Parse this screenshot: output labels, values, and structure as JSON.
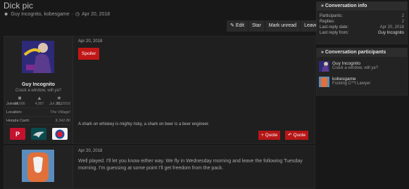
{
  "thread": {
    "title": "Dick pic",
    "participants_line": "Guy Incognito, kobesgame",
    "sep": "·",
    "date": "Apr 20, 2018"
  },
  "actions": {
    "edit": "Edit",
    "star": "Star",
    "mark_unread": "Mark unread",
    "leave": "Leave"
  },
  "post1": {
    "date": "Apr 20, 2018",
    "user": {
      "name": "Guy Incognito",
      "title": "Crack a window, will ya?"
    },
    "stats": [
      {
        "icon": "messages-icon",
        "value": "24,006"
      },
      {
        "icon": "thumbs-up-icon",
        "value": "4,997"
      },
      {
        "icon": "trophy-icon",
        "value": "293"
      }
    ],
    "fields": [
      {
        "label": "Joined:",
        "value": "Jul 26, 2016"
      },
      {
        "label": "Location:",
        "value": "The Village!"
      },
      {
        "label": "Hoopla Cash:",
        "value": "$ 342.86"
      }
    ],
    "spoiler": "Spoiler",
    "signature": "A shark on whiskey is mighty risky, a shark on beer is a beer engineer.",
    "quote_plus": "+ Quote",
    "quote": "Quote"
  },
  "post2": {
    "date": "Apr 20, 2018",
    "body": "Well played. I'll let you know either way. We fly in Wednesday morning and leave the following Tuesday morning. I'm guessing at some point I'll get freedom from the pack."
  },
  "conv_info": {
    "heading": "Conversation info",
    "rows": [
      {
        "label": "Participants:",
        "value": "2"
      },
      {
        "label": "Replies:",
        "value": "2"
      },
      {
        "label": "Last reply date:",
        "value": "Apr 20, 2018"
      },
      {
        "label": "Last reply from:",
        "value": "Guy Incognito"
      }
    ]
  },
  "conv_participants": {
    "heading": "Conversation participants",
    "people": [
      {
        "name": "Guy Incognito",
        "tagline": "Crack a window, will ya?"
      },
      {
        "name": "kobesgame",
        "tagline": "Fucking C**t Lawyer"
      }
    ]
  },
  "colors": {
    "accent": "#c01616",
    "bg": "#181818"
  }
}
